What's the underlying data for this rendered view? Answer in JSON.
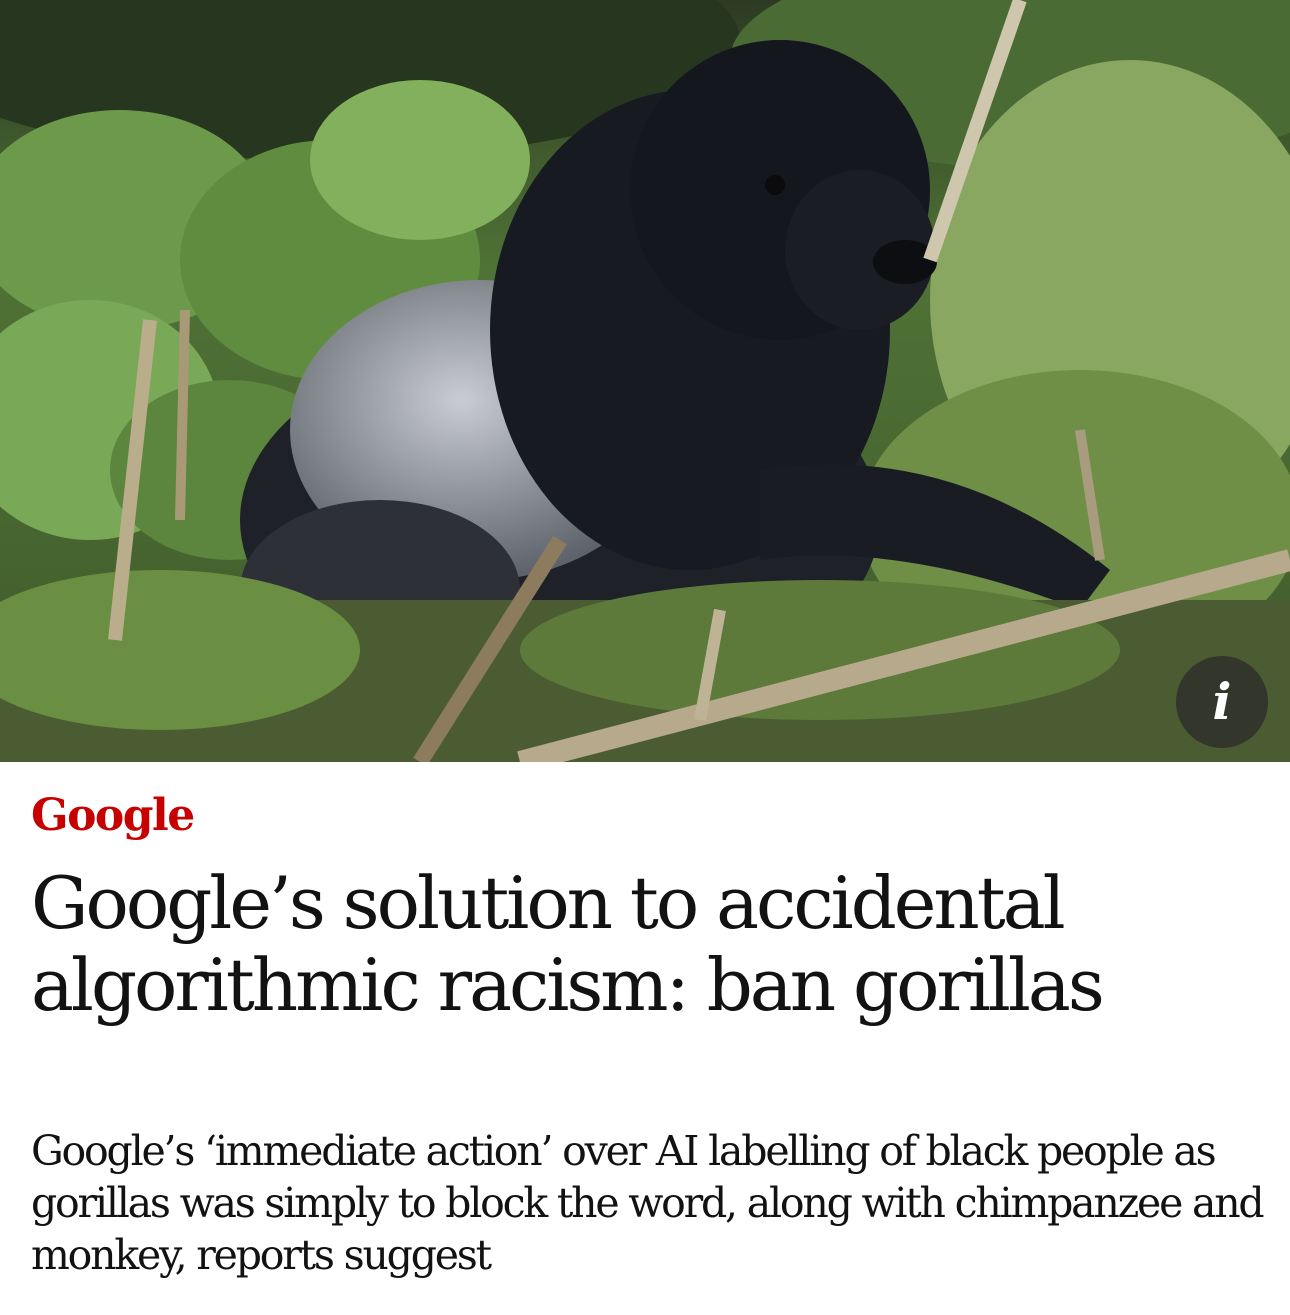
{
  "article": {
    "kicker": "Google",
    "headline": "Google’s solution to accidental algorithmic racism: ban gorillas",
    "standfirst": "Google’s ‘immediate action’ over AI labelling of black people as gorillas was simply to block the word, along with chimpanzee and monkey, reports suggest"
  },
  "image": {
    "info_label": "i",
    "info_icon": "info-icon"
  },
  "colors": {
    "kicker": "#c70000",
    "text": "#121212",
    "background": "#ffffff"
  }
}
